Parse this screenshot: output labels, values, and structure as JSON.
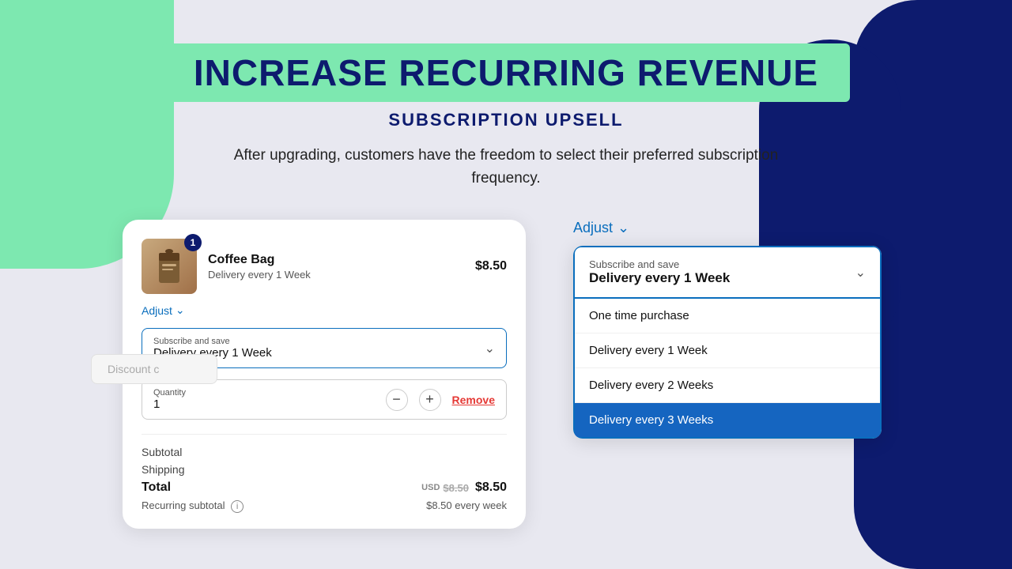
{
  "page": {
    "bg_green": true,
    "bg_navy": true
  },
  "header": {
    "main_title": "INCREASE RECURRING REVENUE",
    "subtitle": "SUBSCRIPTION UPSELL",
    "description": "After upgrading, customers have the freedom to select their preferred subscription frequency."
  },
  "cart": {
    "product": {
      "name": "Coffee Bag",
      "delivery": "Delivery every 1 Week",
      "price": "$8.50",
      "badge": "1"
    },
    "adjust_label": "Adjust",
    "subscribe_label": "Subscribe and save",
    "subscribe_value": "Delivery every 1 Week",
    "discount_placeholder": "Discount c",
    "quantity_label": "Quantity",
    "quantity_value": "1",
    "minus_label": "−",
    "plus_label": "+",
    "remove_label": "Remove",
    "subtotal_label": "Subtotal",
    "shipping_label": "Shipping",
    "total_label": "Total",
    "total_usd": "USD",
    "total_strike": "$8.50",
    "total_amount": "$8.50",
    "recurring_label": "Recurring subtotal",
    "recurring_amount": "$8.50 every week"
  },
  "right_dropdown": {
    "adjust_label": "Adjust",
    "header_top": "Subscribe and save",
    "header_value": "Delivery every 1 Week",
    "options": [
      {
        "label": "One time purchase",
        "selected": false
      },
      {
        "label": "Delivery every 1 Week",
        "selected": false
      },
      {
        "label": "Delivery every 2 Weeks",
        "selected": false
      },
      {
        "label": "Delivery every 3 Weeks",
        "selected": true
      }
    ]
  }
}
